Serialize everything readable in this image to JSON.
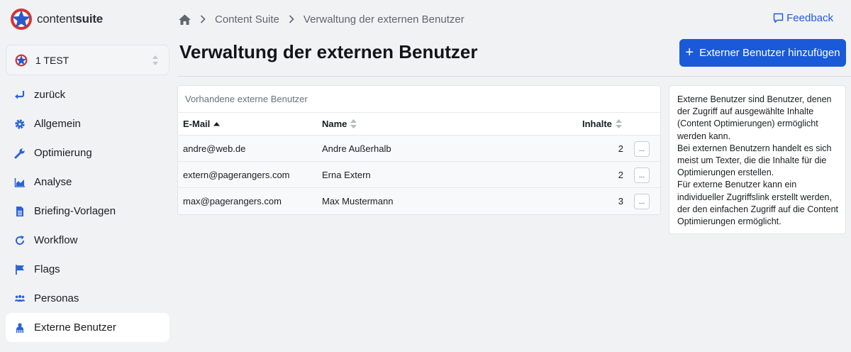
{
  "app": {
    "logo_text_light": "content",
    "logo_text_bold": "suite"
  },
  "project": {
    "name": "1 TEST"
  },
  "sidebar": {
    "items": [
      {
        "label": "zurück",
        "icon": "arrow-return-icon"
      },
      {
        "label": "Allgemein",
        "icon": "gear-icon"
      },
      {
        "label": "Optimierung",
        "icon": "wrench-icon"
      },
      {
        "label": "Analyse",
        "icon": "area-chart-icon"
      },
      {
        "label": "Briefing-Vorlagen",
        "icon": "document-icon"
      },
      {
        "label": "Workflow",
        "icon": "refresh-icon"
      },
      {
        "label": "Flags",
        "icon": "flag-icon"
      },
      {
        "label": "Personas",
        "icon": "users-icon"
      },
      {
        "label": "Externe Benutzer",
        "icon": "external-user-icon",
        "active": true
      }
    ]
  },
  "breadcrumb": {
    "items": [
      "Content Suite",
      "Verwaltung der externen Benutzer"
    ]
  },
  "header": {
    "feedback_label": "Feedback",
    "title": "Verwaltung der externen Benutzer",
    "add_button_label": "Externer Benutzer hinzufügen"
  },
  "table": {
    "caption": "Vorhandene externe Benutzer",
    "columns": {
      "email": "E-Mail",
      "name": "Name",
      "inhalte": "Inhalte"
    },
    "rows": [
      {
        "email": "andre@web.de",
        "name": "Andre Außerhalb",
        "count": "2",
        "action": "..."
      },
      {
        "email": "extern@pagerangers.com",
        "name": "Erna Extern",
        "count": "2",
        "action": "..."
      },
      {
        "email": "max@pagerangers.com",
        "name": "Max Mustermann",
        "count": "3",
        "action": "..."
      }
    ]
  },
  "info": {
    "paragraphs": [
      "Externe Benutzer sind Benutzer, denen der Zugriff auf ausgewählte Inhalte (Content Optimierungen) ermöglicht werden kann.",
      "Bei externen Benutzern handelt es sich meist um Texter, die die Inhalte für die Optimierungen erstellen.",
      "Für externe Benutzer kann ein individueller Zugriffslink erstellt werden, der den einfachen Zugriff auf die Content Optimierungen ermöglicht."
    ]
  },
  "colors": {
    "accent": "#1a5ad8",
    "link": "#1f5bd8",
    "icon_blue": "#2a63d6",
    "background": "#f1f2f4"
  }
}
